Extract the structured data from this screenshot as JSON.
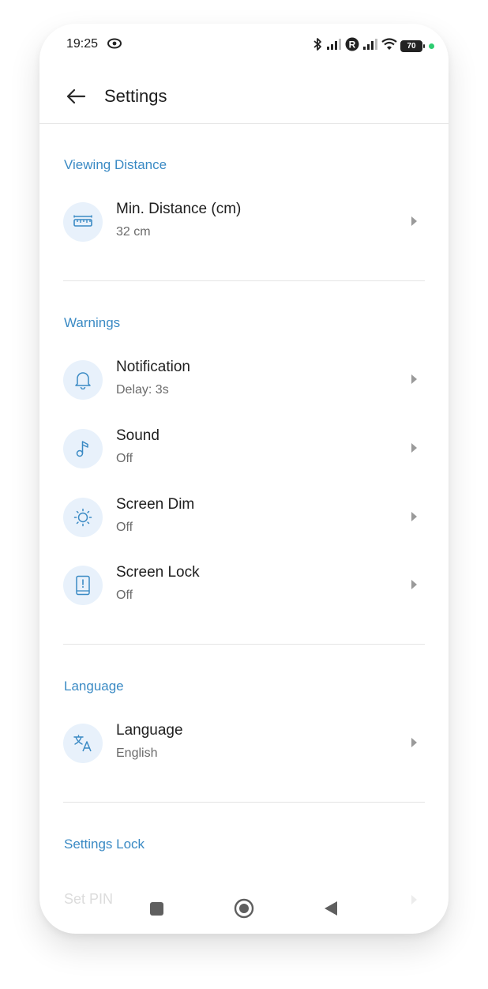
{
  "status_bar": {
    "time": "19:25",
    "battery_level": "70",
    "icons": [
      "eye-icon",
      "bluetooth-icon",
      "signal-icon",
      "roaming-icon",
      "signal-icon",
      "wifi-icon",
      "battery-icon"
    ]
  },
  "app_bar": {
    "title": "Settings",
    "back_icon": "arrow-left-icon"
  },
  "sections": {
    "viewing_distance": {
      "title": "Viewing Distance",
      "items": [
        {
          "title": "Min. Distance (cm)",
          "subtitle": "32 cm",
          "icon": "ruler-icon"
        }
      ]
    },
    "warnings": {
      "title": "Warnings",
      "items": [
        {
          "title": "Notification",
          "subtitle": "Delay: 3s",
          "icon": "bell-icon"
        },
        {
          "title": "Sound",
          "subtitle": "Off",
          "icon": "music-note-icon"
        },
        {
          "title": "Screen Dim",
          "subtitle": "Off",
          "icon": "brightness-icon"
        },
        {
          "title": "Screen Lock",
          "subtitle": "Off",
          "icon": "phone-lock-icon"
        }
      ]
    },
    "language": {
      "title": "Language",
      "items": [
        {
          "title": "Language",
          "subtitle": "English",
          "icon": "translate-icon"
        }
      ]
    },
    "settings_lock": {
      "title": "Settings Lock",
      "items": [
        {
          "title": "Set PIN"
        }
      ]
    }
  },
  "nav_bar": {
    "buttons": [
      "recents-button",
      "home-button",
      "back-button"
    ]
  },
  "colors": {
    "accent": "#3a8ac4",
    "icon_bg": "#e8f1fb",
    "divider": "#e4e4e4"
  }
}
